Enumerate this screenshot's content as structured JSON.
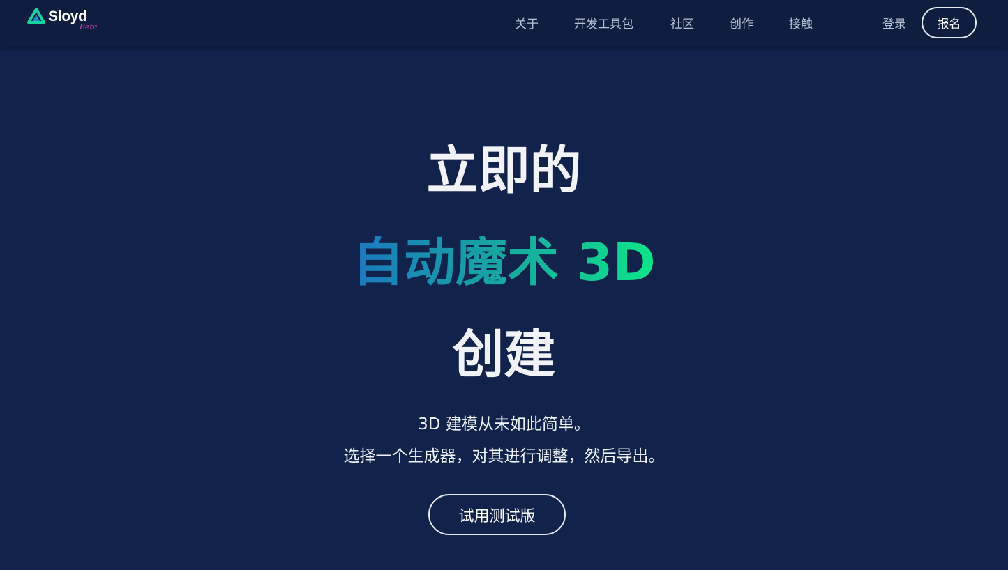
{
  "brand": {
    "name": "Sloyd",
    "tag": "Beta",
    "colors": {
      "beta": "#d449c4",
      "logo_primary": "#14d3a0",
      "logo_secondary": "#1a8fc9"
    }
  },
  "nav": {
    "links": [
      "关于",
      "开发工具包",
      "社区",
      "创作",
      "接触"
    ],
    "login_label": "登录",
    "signup_label": "报名"
  },
  "hero": {
    "line1": "立即的",
    "line2": "自动魔术 3D",
    "line3": "创建",
    "subtitle1": "3D 建模从未如此简单。",
    "subtitle2": "选择一个生成器，对其进行调整，然后导出。",
    "cta_label": "试用测试版",
    "gradient": {
      "start": "#1c78c0",
      "mid": "#17a8a0",
      "end": "#0de58a"
    }
  },
  "colors": {
    "background": "#11224b",
    "navbar": "#0f1d3e"
  }
}
